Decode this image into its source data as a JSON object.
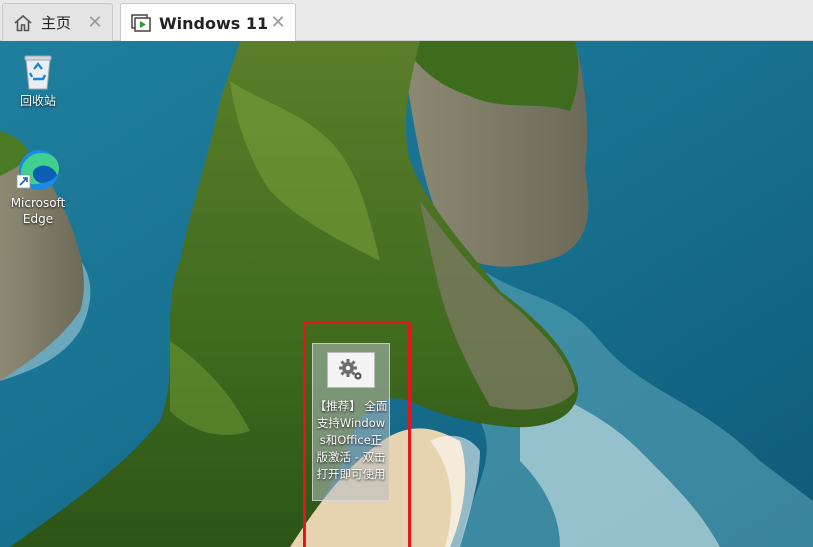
{
  "tabs": [
    {
      "label": "主页",
      "icon": "home-icon",
      "active": false
    },
    {
      "label": "Windows 11",
      "icon": "vm-play-icon",
      "active": true
    }
  ],
  "desktop": {
    "icons": [
      {
        "label": "回收站",
        "icon": "recycle-bin-icon"
      },
      {
        "label": "Microsoft Edge",
        "icon": "edge-icon"
      }
    ],
    "highlighted_shortcut": {
      "label": "【推荐】 全面支持Windows和Office正版激活 - 双击打开即可使用",
      "icon": "gears-icon"
    },
    "highlight_color": "#e8141c"
  }
}
